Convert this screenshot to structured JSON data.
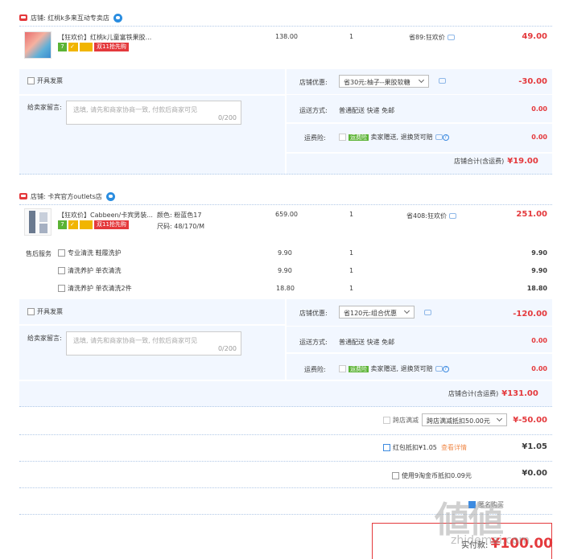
{
  "shop1": {
    "name": "店铺: 红桃k多来互动专卖店",
    "item": {
      "title": "【狂欢价】红桃k儿童富铁果胶...",
      "tag_7": "7",
      "tag_pay": "✓",
      "tag_double11": "双11抢先购",
      "unit_price": "138.00",
      "qty": "1",
      "discount": "省89:狂欢价",
      "subtotal": "49.00"
    },
    "invoice_label": "开具发票",
    "shop_promo_label": "店铺优惠:",
    "shop_promo_value": "省30元:柚子--果胶软糖",
    "shop_promo_amount": "-30.00",
    "message_label": "给卖家留言:",
    "message_placeholder": "选填, 请先和商家协商一致, 付款后商家可见",
    "message_count": "0/200",
    "shipping_label": "运送方式:",
    "shipping_value": "普通配送 快递 免邮",
    "shipping_amount": "0.00",
    "insurance_label": "运费险:",
    "insurance_tag": "运费险",
    "insurance_value": "卖家赠送, 退换货可赔",
    "insurance_amount": "0.00",
    "total_label": "店铺合计(含运费)",
    "total_value": "¥19.00"
  },
  "shop2": {
    "name": "店铺: 卡宾官方outlets店",
    "item": {
      "title": "【狂欢价】Cabbeen/卡宾男装...",
      "tag_7": "7",
      "tag_pay": "✓",
      "tag_double11": "双11抢先购",
      "color": "颜色: 粉蓝色17",
      "size": "尺码: 48/170/M",
      "unit_price": "659.00",
      "qty": "1",
      "discount": "省408:狂欢价",
      "subtotal": "251.00"
    },
    "after_sale_label": "售后服务",
    "services": [
      {
        "name": "专业清洗 鞋履洗护",
        "price": "9.90",
        "qty": "1",
        "total": "9.90"
      },
      {
        "name": "清洗养护 单衣清洗",
        "price": "9.90",
        "qty": "1",
        "total": "9.90"
      },
      {
        "name": "清洗养护 单衣清洗2件",
        "price": "18.80",
        "qty": "1",
        "total": "18.80"
      }
    ],
    "invoice_label": "开具发票",
    "shop_promo_label": "店铺优惠:",
    "shop_promo_value": "省120元:组合优惠",
    "shop_promo_amount": "-120.00",
    "message_label": "给卖家留言:",
    "message_placeholder": "选填, 请先和商家协商一致, 付款后商家可见",
    "message_count": "0/200",
    "shipping_label": "运送方式:",
    "shipping_value": "普通配送 快递 免邮",
    "shipping_amount": "0.00",
    "insurance_label": "运费险:",
    "insurance_tag": "运费险",
    "insurance_value": "卖家赠送, 退换货可赔",
    "insurance_amount": "0.00",
    "total_label": "店铺合计(含运费)",
    "total_value": "¥131.00"
  },
  "cross_shop": {
    "label": "跨店满减",
    "select_value": "跨店满减抵扣50.00元",
    "amount": "¥-50.00"
  },
  "red_packet": {
    "label": "红包抵扣¥1.05",
    "link": "查看详情",
    "amount": "¥1.05"
  },
  "gold_coin": {
    "label": "使用9淘金币抵扣0.09元",
    "amount": "¥0.00"
  },
  "footer": {
    "anon_label": "匿名购买",
    "pay_label": "实付款:",
    "pay_value": "¥100.00"
  },
  "watermark": "值 什么值得买 zhidemai.com"
}
